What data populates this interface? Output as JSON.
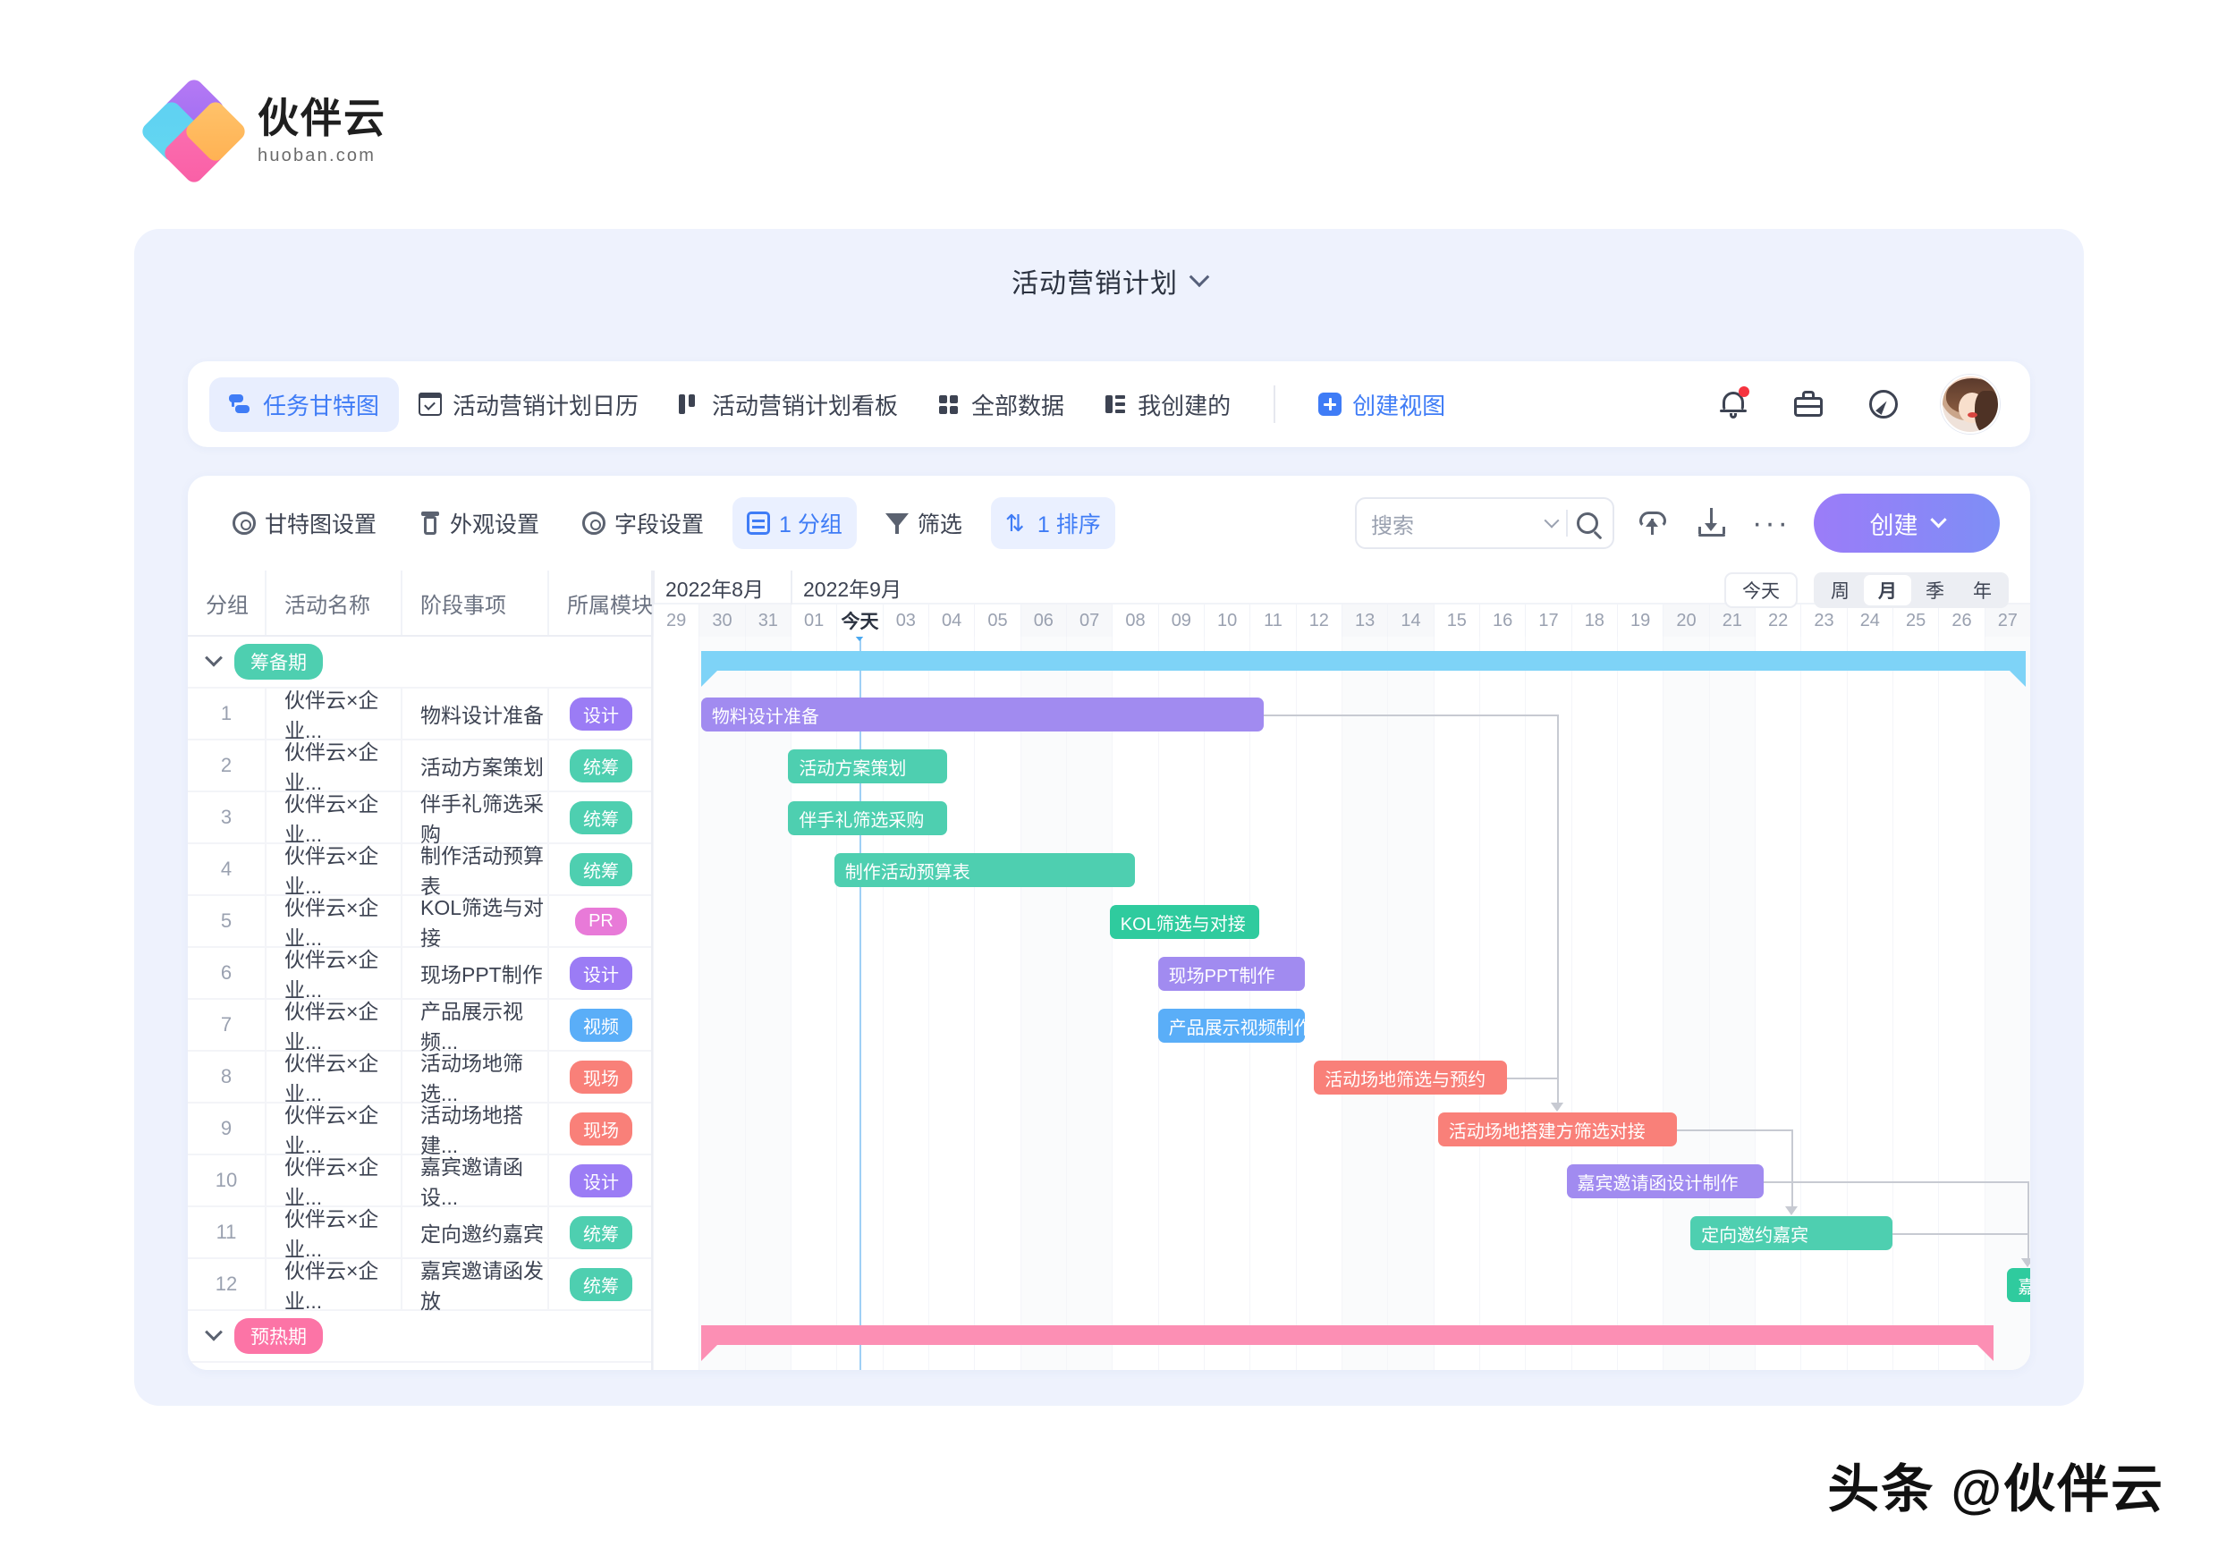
{
  "brand": {
    "name_cn": "伙伴云",
    "name_en": "huoban.com"
  },
  "header": {
    "title": "活动营销计划"
  },
  "tabs": [
    {
      "label": "任务甘特图",
      "icon": "gantt-icon",
      "active": true
    },
    {
      "label": "活动营销计划日历",
      "icon": "calendar-icon",
      "active": false
    },
    {
      "label": "活动营销计划看板",
      "icon": "kanban-icon",
      "active": false
    },
    {
      "label": "全部数据",
      "icon": "grid-icon",
      "active": false
    },
    {
      "label": "我创建的",
      "icon": "list-icon",
      "active": false
    }
  ],
  "create_view": {
    "label": "创建视图",
    "icon": "plus-square-icon"
  },
  "header_icons": [
    {
      "name": "notification-bell-icon",
      "badge": true
    },
    {
      "name": "briefcase-icon",
      "badge": false
    },
    {
      "name": "compass-icon",
      "badge": false
    },
    {
      "name": "user-avatar",
      "badge": false
    }
  ],
  "toolbar": {
    "items": [
      {
        "label": "甘特图设置",
        "icon": "gear-icon",
        "highlight": false
      },
      {
        "label": "外观设置",
        "icon": "paint-icon",
        "highlight": false
      },
      {
        "label": "字段设置",
        "icon": "gear-icon",
        "highlight": false
      },
      {
        "label": "1 分组",
        "icon": "group-icon",
        "highlight": true
      },
      {
        "label": "筛选",
        "icon": "filter-icon",
        "highlight": false
      },
      {
        "label": "1 排序",
        "icon": "sort-icon",
        "highlight": true
      }
    ],
    "search_placeholder": "搜索",
    "search_value": "",
    "upload_icon": "cloud-upload-icon",
    "download_icon": "download-icon",
    "more_icon": "more-options-icon",
    "create_button": "创建"
  },
  "table": {
    "columns": [
      "分组",
      "活动名称",
      "阶段事项",
      "所属模块"
    ],
    "groups": [
      {
        "name": "筹备期",
        "color": "#4ecfb0",
        "rows": [
          {
            "no": "1",
            "activity": "伙伴云×企业...",
            "stage": "物料设计准备",
            "module": "设计",
            "module_color": "#9b7cf5"
          },
          {
            "no": "2",
            "activity": "伙伴云×企业...",
            "stage": "活动方案策划",
            "module": "统筹",
            "module_color": "#4ecfb0"
          },
          {
            "no": "3",
            "activity": "伙伴云×企业...",
            "stage": "伴手礼筛选采购",
            "module": "统筹",
            "module_color": "#4ecfb0"
          },
          {
            "no": "4",
            "activity": "伙伴云×企业...",
            "stage": "制作活动预算表",
            "module": "统筹",
            "module_color": "#4ecfb0"
          },
          {
            "no": "5",
            "activity": "伙伴云×企业...",
            "stage": "KOL筛选与对接",
            "module": "PR",
            "module_color": "#e87ad8"
          },
          {
            "no": "6",
            "activity": "伙伴云×企业...",
            "stage": "现场PPT制作",
            "module": "设计",
            "module_color": "#9b7cf5"
          },
          {
            "no": "7",
            "activity": "伙伴云×企业...",
            "stage": "产品展示视频...",
            "module": "视频",
            "module_color": "#5aaef8"
          },
          {
            "no": "8",
            "activity": "伙伴云×企业...",
            "stage": "活动场地筛选...",
            "module": "现场",
            "module_color": "#f98079"
          },
          {
            "no": "9",
            "activity": "伙伴云×企业...",
            "stage": "活动场地搭建...",
            "module": "现场",
            "module_color": "#f98079"
          },
          {
            "no": "10",
            "activity": "伙伴云×企业...",
            "stage": "嘉宾邀请函设...",
            "module": "设计",
            "module_color": "#9b7cf5"
          },
          {
            "no": "11",
            "activity": "伙伴云×企业...",
            "stage": "定向邀约嘉宾",
            "module": "统筹",
            "module_color": "#4ecfb0"
          },
          {
            "no": "12",
            "activity": "伙伴云×企业...",
            "stage": "嘉宾邀请函发放",
            "module": "统筹",
            "module_color": "#4ecfb0"
          }
        ]
      },
      {
        "name": "预热期",
        "color": "#fc74a6",
        "rows": []
      }
    ]
  },
  "timeline": {
    "months": [
      {
        "label": "2022年8月",
        "start_day_index": 0,
        "span": 3
      },
      {
        "label": "2022年9月",
        "start_day_index": 3,
        "span": 27
      }
    ],
    "days": [
      "29",
      "30",
      "31",
      "01",
      "今天",
      "03",
      "04",
      "05",
      "06",
      "07",
      "08",
      "09",
      "10",
      "11",
      "12",
      "13",
      "14",
      "15",
      "16",
      "17",
      "18",
      "19",
      "20",
      "21",
      "22",
      "23",
      "24",
      "25",
      "26",
      "27"
    ],
    "today_index": 4,
    "today_label": "今天",
    "weekend_indexes": [
      1,
      2,
      8,
      9,
      15,
      16,
      22,
      23,
      29
    ],
    "controls": {
      "today": "今天",
      "scales": [
        "周",
        "月",
        "季",
        "年"
      ],
      "scale_active": "月"
    }
  },
  "chart_data": {
    "type": "gantt",
    "title": "活动营销计划 任务甘特图",
    "x_axis": {
      "unit": "day",
      "labels": [
        "29",
        "30",
        "31",
        "01",
        "02(今天)",
        "03",
        "04",
        "05",
        "06",
        "07",
        "08",
        "09",
        "10",
        "11",
        "12",
        "13",
        "14",
        "15",
        "16",
        "17",
        "18",
        "19",
        "20",
        "21",
        "22",
        "23",
        "24",
        "25",
        "26",
        "27"
      ],
      "range": [
        "2022-08-29",
        "2022-09-27"
      ]
    },
    "summary_bars": [
      {
        "name": "筹备期",
        "color": "#7ed3f7",
        "start_index": 1.05,
        "end_index": 29.9,
        "row": 0
      },
      {
        "name": "预热期",
        "color": "#fc8fb4",
        "start_index": 1.05,
        "end_index": 29.2,
        "row": 13
      }
    ],
    "tasks": [
      {
        "no": 1,
        "name": "物料设计准备",
        "color": "#a18bf0",
        "start_index": 1.05,
        "end_index": 13.3,
        "row": 1
      },
      {
        "no": 2,
        "name": "活动方案策划",
        "color": "#4ecfb0",
        "start_index": 2.95,
        "end_index": 6.4,
        "row": 2
      },
      {
        "no": 3,
        "name": "伴手礼筛选采购",
        "color": "#4ecfb0",
        "start_index": 2.95,
        "end_index": 6.4,
        "row": 3
      },
      {
        "no": 4,
        "name": "制作活动预算表",
        "color": "#4ecfb0",
        "start_index": 3.95,
        "end_index": 10.5,
        "row": 4
      },
      {
        "no": 5,
        "name": "KOL筛选与对接",
        "color": "#2fcb9e",
        "start_index": 9.95,
        "end_index": 13.2,
        "row": 5
      },
      {
        "no": 6,
        "name": "现场PPT制作",
        "color": "#a18bf0",
        "start_index": 11.0,
        "end_index": 14.2,
        "row": 6
      },
      {
        "no": 7,
        "name": "产品展示视频制作",
        "color": "#5aaef8",
        "start_index": 11.0,
        "end_index": 14.2,
        "row": 7
      },
      {
        "no": 8,
        "name": "活动场地筛选与预约",
        "color": "#f98079",
        "start_index": 14.4,
        "end_index": 18.6,
        "row": 8
      },
      {
        "no": 9,
        "name": "活动场地搭建方筛选对接",
        "color": "#f98079",
        "start_index": 17.1,
        "end_index": 22.3,
        "row": 9
      },
      {
        "no": 10,
        "name": "嘉宾邀请函设计制作",
        "color": "#a18bf0",
        "start_index": 19.9,
        "end_index": 24.2,
        "row": 10
      },
      {
        "no": 11,
        "name": "定向邀约嘉宾",
        "color": "#4ecfb0",
        "start_index": 22.6,
        "end_index": 27.0,
        "row": 11
      },
      {
        "no": 12,
        "name": "嘉宾邀请函发放",
        "color": "#2fcb9e",
        "start_index": 29.5,
        "end_index": 30.4,
        "row": 12
      }
    ],
    "dependencies": [
      {
        "from": 1,
        "to": 9
      },
      {
        "from": 8,
        "to": 9
      },
      {
        "from": 9,
        "to": 11
      },
      {
        "from": 10,
        "to": 12
      },
      {
        "from": 11,
        "to": 12
      }
    ]
  },
  "watermark": "头条 @伙伴云"
}
